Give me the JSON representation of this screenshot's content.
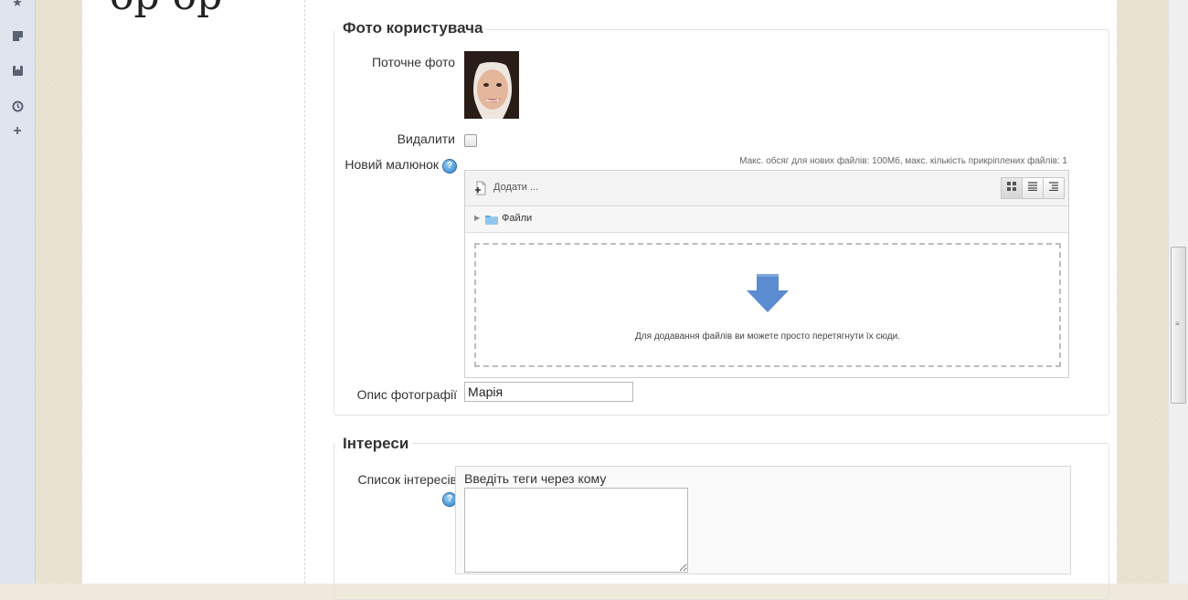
{
  "top_cut_text": "ор ор",
  "dock": {
    "icons": [
      "star-icon",
      "note-icon",
      "bookmark-icon",
      "clock-icon",
      "plus-icon"
    ]
  },
  "photo_section": {
    "legend": "Фото користувача",
    "current_photo_label": "Поточне фото",
    "delete_label": "Видалити",
    "new_picture_label": "Новий малюнок",
    "limits_text": "Макс. обсяг для нових файлів: 100Мб, макс. кількість прикріплених файлів: 1",
    "add_label": "Додати ...",
    "folder_label": "Файли",
    "drop_text": "Для додавання файлів ви можете просто перетягнути їх сюди.",
    "description_label": "Опис фотографії",
    "description_value": "Марія"
  },
  "interests_section": {
    "legend": "Інтереси",
    "list_label": "Список інтересів",
    "hint": "Введіть теги через кому",
    "textarea_value": ""
  },
  "colors": {
    "accent_arrow": "#5b8bd0",
    "help_icon": "#2d7fc6"
  }
}
